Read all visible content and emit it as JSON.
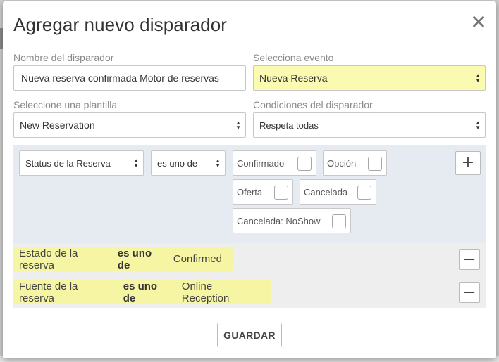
{
  "modal": {
    "title": "Agregar nuevo disparador",
    "close_symbol": "✕",
    "save_label": "GUARDAR"
  },
  "trigger_name": {
    "label": "Nombre del disparador",
    "value": "Nueva reserva confirmada Motor de reservas"
  },
  "event": {
    "label": "Selecciona evento",
    "selected": "Nueva Reserva",
    "highlight_color": "#fafab0"
  },
  "template": {
    "label": "Seleccione una plantilla",
    "selected": "New Reservation"
  },
  "conditions": {
    "label": "Condiciones del disparador",
    "selected": "Respeta todas"
  },
  "builder": {
    "field_selected": "Status de la Reserva",
    "operator_selected": "es uno de",
    "options": [
      {
        "label": "Confirmado",
        "checked": false
      },
      {
        "label": "Opción",
        "checked": false
      },
      {
        "label": "Oferta",
        "checked": false
      },
      {
        "label": "Cancelada",
        "checked": false
      },
      {
        "label": "Cancelada: NoShow",
        "checked": false
      }
    ],
    "add_symbol": "+"
  },
  "rules": [
    {
      "field": "Estado de la reserva",
      "operator": "es uno de",
      "value": "Confirmed",
      "remove_symbol": "—"
    },
    {
      "field": "Fuente de la reserva",
      "operator": "es uno de",
      "value": "Online Reception",
      "remove_symbol": "—"
    }
  ],
  "colors": {
    "panel_bg": "#e6ebf2",
    "rule_highlight": "#f5f5a3"
  }
}
